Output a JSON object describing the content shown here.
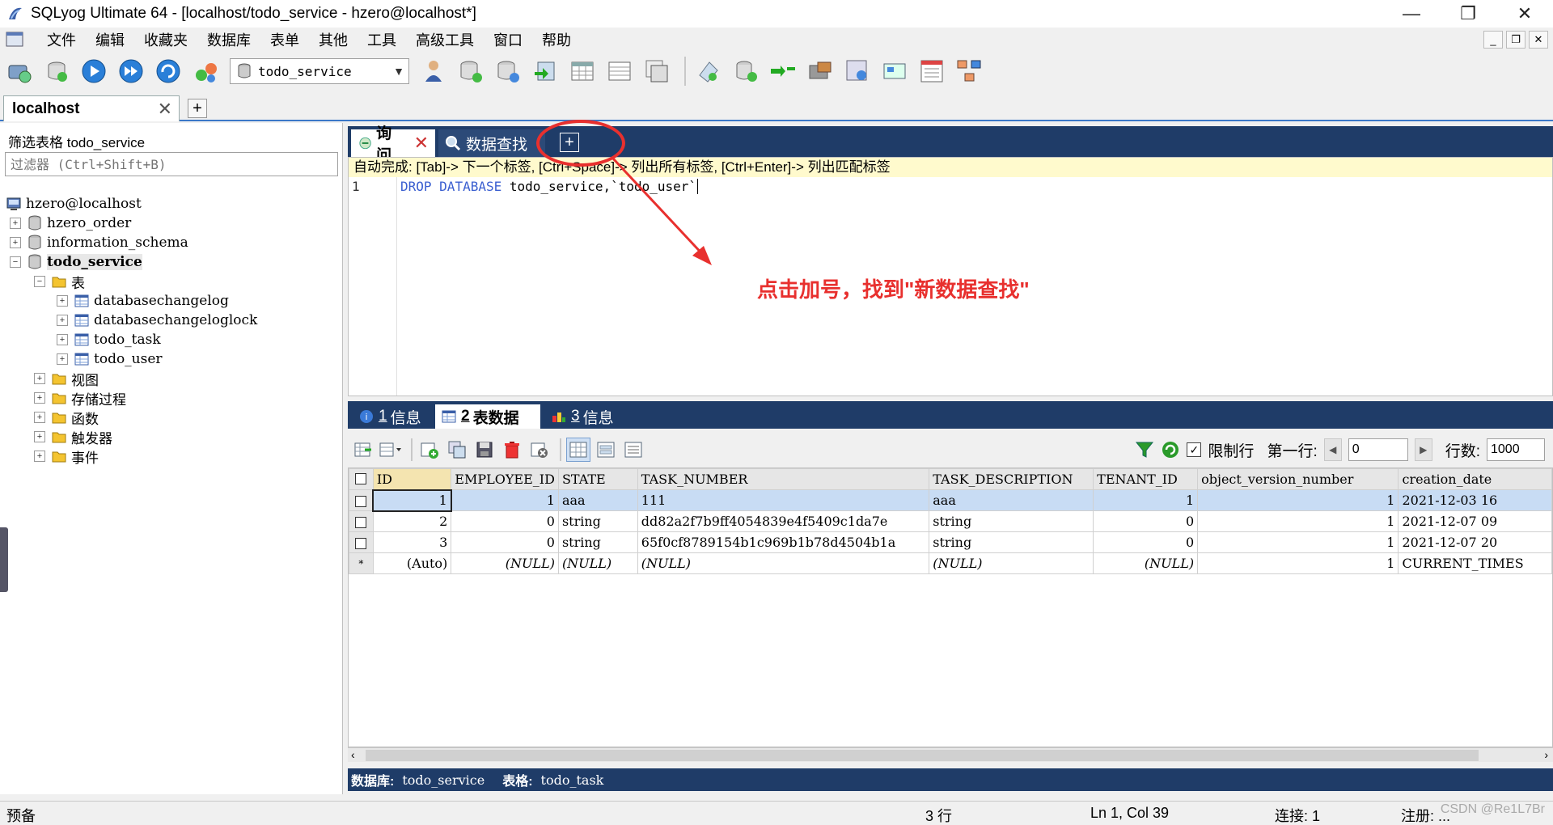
{
  "window": {
    "title": "SQLyog Ultimate 64 - [localhost/todo_service - hzero@localhost*]",
    "controls": [
      "—",
      "❐",
      "✕"
    ]
  },
  "menu": {
    "items": [
      "文件",
      "编辑",
      "收藏夹",
      "数据库",
      "表单",
      "其他",
      "工具",
      "高级工具",
      "窗口",
      "帮助"
    ],
    "mdi_controls": [
      "_",
      "❐",
      "✕"
    ]
  },
  "toolbar": {
    "database_selected": "todo_service"
  },
  "connection_tab": {
    "label": "localhost",
    "add": "+"
  },
  "object_browser": {
    "filter_label": "筛选表格 todo_service",
    "filter_placeholder": "过滤器 (Ctrl+Shift+B)",
    "root": "hzero@localhost",
    "databases": [
      "hzero_order",
      "information_schema",
      "todo_service"
    ],
    "tables_folder": "表",
    "tables": [
      "databasechangelog",
      "databasechangeloglock",
      "todo_task",
      "todo_user"
    ],
    "folders": [
      "视图",
      "存储过程",
      "函数",
      "触发器",
      "事件"
    ]
  },
  "query_tabs": {
    "query": "询问",
    "search": "数据查找",
    "add": "+"
  },
  "editor": {
    "autocomplete_hint": "自动完成: [Tab]-> 下一个标签, [Ctrl+Space]-> 列出所有标签, [Ctrl+Enter]-> 列出匹配标签",
    "line_number": "1",
    "kw1": "DROP",
    "kw2": "DATABASE",
    "rest": " todo_service,`todo_user`"
  },
  "result_tabs": [
    {
      "num": "1",
      "label": "信息"
    },
    {
      "num": "2",
      "label": "表数据"
    },
    {
      "num": "3",
      "label": "信息"
    }
  ],
  "result_toolbar": {
    "limit_label": "限制行",
    "first_row_label": "第一行:",
    "first_row_value": "0",
    "rows_label": "行数:",
    "rows_value": "1000"
  },
  "grid": {
    "columns": [
      "ID",
      "EMPLOYEE_ID",
      "STATE",
      "TASK_NUMBER",
      "TASK_DESCRIPTION",
      "TENANT_ID",
      "object_version_number",
      "creation_date"
    ],
    "rows": [
      [
        "1",
        "1",
        "aaa",
        "111",
        "aaa",
        "1",
        "1",
        "2021-12-03 16"
      ],
      [
        "2",
        "0",
        "string",
        "dd82a2f7b9ff4054839e4f5409c1da7e",
        "string",
        "0",
        "1",
        "2021-12-07 09"
      ],
      [
        "3",
        "0",
        "string",
        "65f0cf8789154b1c969b1b78d4504b1a",
        "string",
        "0",
        "1",
        "2021-12-07 20"
      ],
      [
        "(Auto)",
        "(NULL)",
        "(NULL)",
        "(NULL)",
        "(NULL)",
        "(NULL)",
        "1",
        "CURRENT_TIMES"
      ]
    ]
  },
  "db_info": {
    "db_label": "数据库:",
    "db_value": "todo_service",
    "table_label": "表格:",
    "table_value": "todo_task"
  },
  "statusbar": {
    "left": "预备",
    "rows": "3 行",
    "cursor": "Ln 1, Col 39",
    "connections": "连接: 1",
    "extra": "注册: ..."
  },
  "annotation": {
    "text": "点击加号，找到\"新数据查找\""
  },
  "watermark": "CSDN @Re1L7Br",
  "colors": {
    "annotation": "#e8302e",
    "tab_strip": "#1f3c68",
    "selection": "#c8dcf4"
  }
}
